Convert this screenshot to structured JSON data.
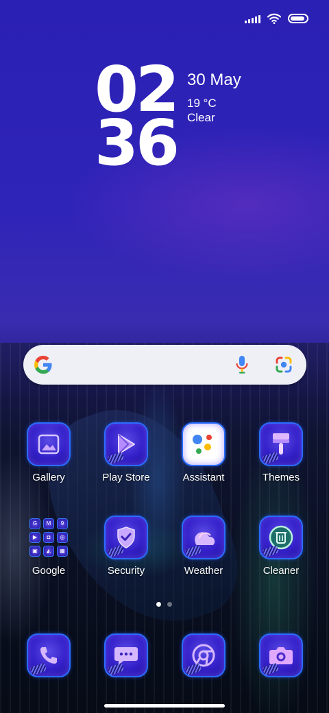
{
  "status_bar": {
    "signal_icon": "signal-icon",
    "wifi_icon": "wifi-icon",
    "battery_icon": "battery-icon",
    "battery_level": 0.9
  },
  "clock": {
    "hours": "02",
    "minutes": "36",
    "date": "30 May",
    "temperature": "19 °C",
    "condition": "Clear"
  },
  "search_bar": {
    "logo_icon": "google-g-icon",
    "mic_icon": "mic-icon",
    "lens_icon": "lens-icon"
  },
  "apps": [
    {
      "label": "Gallery",
      "icon": "gallery-icon"
    },
    {
      "label": "Play Store",
      "icon": "play-store-icon"
    },
    {
      "label": "Assistant",
      "icon": "assistant-icon"
    },
    {
      "label": "Themes",
      "icon": "themes-icon"
    },
    {
      "label": "Google",
      "icon": "google-folder-icon"
    },
    {
      "label": "Security",
      "icon": "security-icon"
    },
    {
      "label": "Weather",
      "icon": "weather-icon"
    },
    {
      "label": "Cleaner",
      "icon": "cleaner-icon"
    }
  ],
  "folder_apps": [
    "G",
    "M",
    "9",
    "▶",
    "◘",
    "◎",
    "▣",
    "◭",
    "▦"
  ],
  "dock": [
    {
      "icon": "phone-icon"
    },
    {
      "icon": "messages-icon"
    },
    {
      "icon": "chrome-icon"
    },
    {
      "icon": "camera-icon"
    }
  ],
  "page_indicator": {
    "pages": 2,
    "current": 1
  },
  "colors": {
    "accent": "#2a6dff",
    "icon_glow": "#5a4be6",
    "wallpaper_top": "#2b20b4"
  }
}
